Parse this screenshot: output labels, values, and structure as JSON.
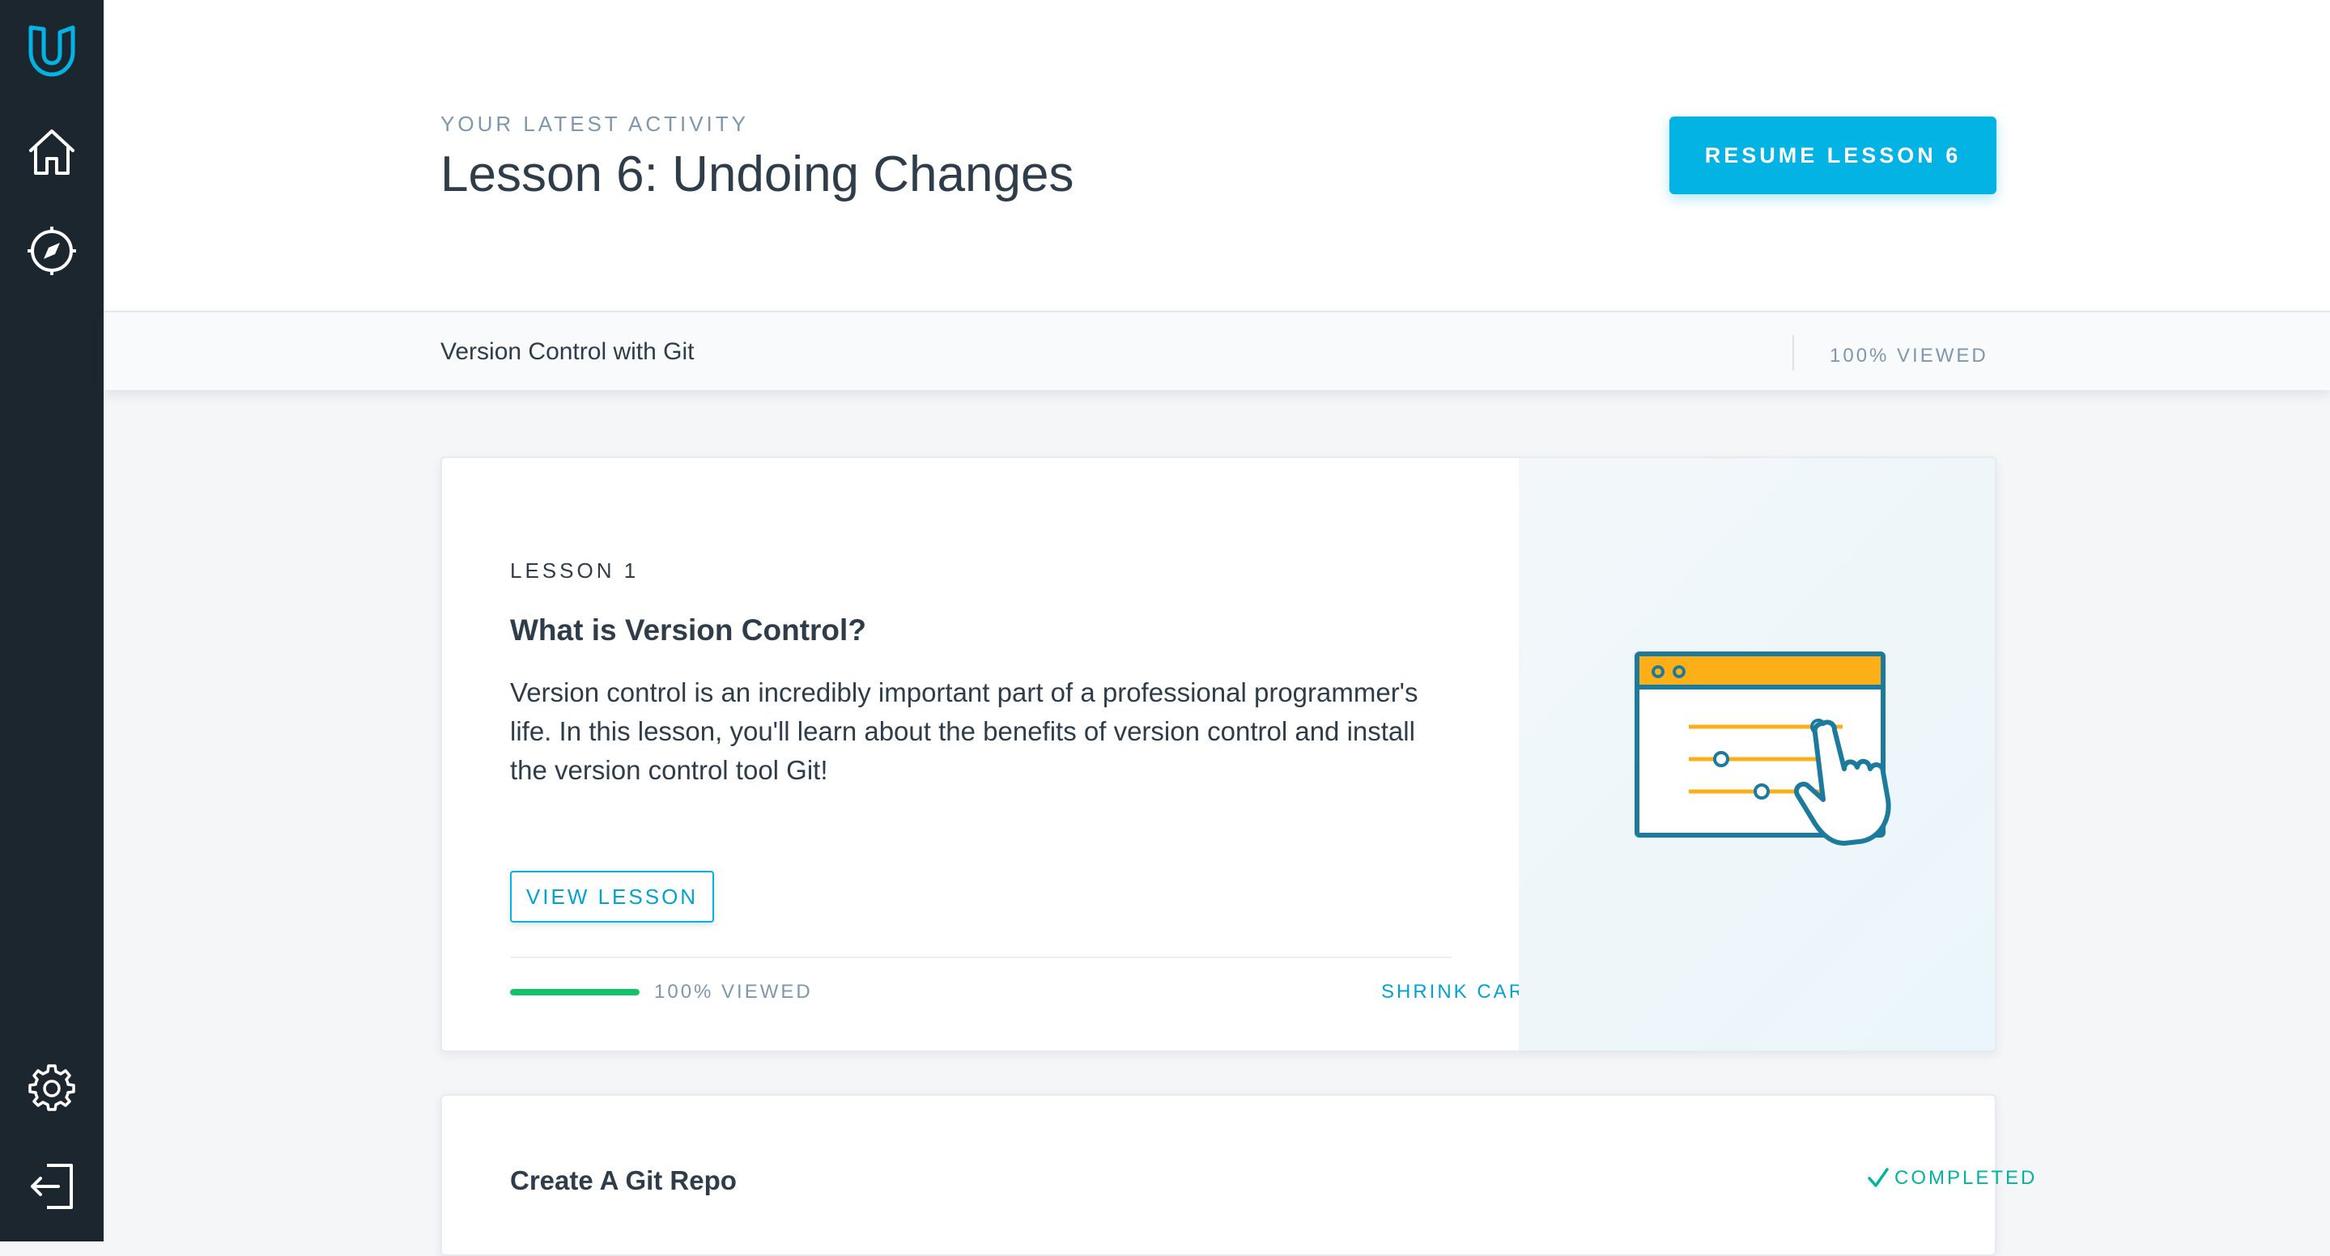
{
  "sidebar": {
    "logo_icon": "udacity-logo-icon",
    "items": [
      {
        "icon": "home-icon"
      },
      {
        "icon": "compass-icon"
      }
    ],
    "bottom_items": [
      {
        "icon": "gear-icon"
      },
      {
        "icon": "logout-icon"
      }
    ]
  },
  "header": {
    "eyebrow": "YOUR LATEST ACTIVITY",
    "title": "Lesson 6: Undoing Changes",
    "resume_label": "RESUME LESSON 6"
  },
  "course": {
    "name": "Version Control with Git",
    "viewed": "100% VIEWED"
  },
  "lessons": [
    {
      "label": "LESSON 1",
      "title": "What is Version Control?",
      "description": "Version control is an incredibly important part of a professional programmer's life. In this lesson, you'll learn about the benefits of version control and install the version control tool Git!",
      "button_label": "VIEW LESSON",
      "progress_percent": 100,
      "progress_text": "100% VIEWED",
      "shrink_label": "SHRINK CARD",
      "illustration": "browser-slider-hand-illustration"
    },
    {
      "title": "Create A Git Repo",
      "status": "COMPLETED",
      "status_icon": "checkmark-icon"
    }
  ],
  "colors": {
    "sidebar_bg": "#1c262f",
    "accent": "#02b3e4",
    "progress_green": "#15c26b",
    "illustration_orange": "#fdaf17",
    "illustration_blue": "#1c7a9c"
  }
}
